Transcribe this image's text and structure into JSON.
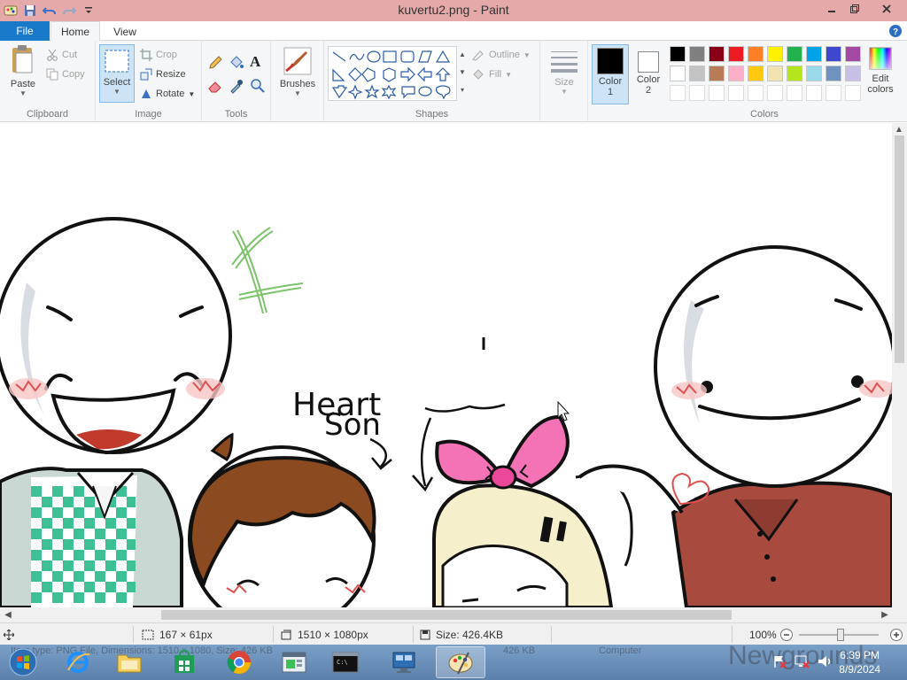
{
  "window": {
    "title": "kuvertu2.png - Paint",
    "title_bar_color": "#e6a9a9"
  },
  "quick_access": {
    "icons": [
      "paint-app-icon",
      "save-icon",
      "undo-icon",
      "redo-icon",
      "customize-qat-icon"
    ]
  },
  "tabs": {
    "file": "File",
    "home": "Home",
    "view": "View",
    "file_color": "#1979ca"
  },
  "ribbon": {
    "clipboard": {
      "label": "Clipboard",
      "paste": "Paste",
      "cut": "Cut",
      "copy": "Copy"
    },
    "image": {
      "label": "Image",
      "select": "Select",
      "crop": "Crop",
      "resize": "Resize",
      "rotate": "Rotate"
    },
    "tools": {
      "label": "Tools",
      "items": [
        "pencil-icon",
        "fill-bucket-icon",
        "text-icon",
        "eraser-icon",
        "color-picker-icon",
        "magnifier-icon"
      ]
    },
    "brushes": {
      "label": "Brushes"
    },
    "shapes": {
      "label": "Shapes",
      "outline": "Outline",
      "fill": "Fill"
    },
    "size": {
      "label": "Size"
    },
    "color1": {
      "label_line1": "Color",
      "label_line2": "1",
      "value": "#000000"
    },
    "color2": {
      "label_line1": "Color",
      "label_line2": "2",
      "value": "#ffffff"
    },
    "colors": {
      "label": "Colors",
      "palette_row1": [
        "#000000",
        "#7f7f7f",
        "#880015",
        "#ed1c24",
        "#ff7f27",
        "#fff200",
        "#22b14c",
        "#00a2e8",
        "#3f48cc",
        "#a349a4"
      ],
      "palette_row2": [
        "#ffffff",
        "#c3c3c3",
        "#b97a57",
        "#ffaec9",
        "#ffc90e",
        "#efe4b0",
        "#b5e61d",
        "#99d9ea",
        "#7092be",
        "#c8bfe7"
      ],
      "edit_line1": "Edit",
      "edit_line2": "colors"
    }
  },
  "canvas": {
    "text_heart": "Heart",
    "text_son": "Son"
  },
  "statusbar": {
    "selection": "167 × 61px",
    "dimensions": "1510 × 1080px",
    "size": "Size: 426.4KB",
    "zoom": "100%"
  },
  "taskbar": {
    "time": "6:39 PM",
    "date": "8/9/2024",
    "apps": [
      "start-icon",
      "internet-explorer-icon",
      "file-explorer-icon",
      "store-icon",
      "chrome-icon",
      "app-window-icon",
      "command-prompt-icon",
      "remote-desktop-icon",
      "paint-taskbar-icon"
    ],
    "ghost_left": "Item type: PNG File, Dimensions: 1510 x 1080, Size: 426 KB",
    "ghost_size": "426 KB",
    "ghost_computer": "Computer",
    "watermark": "Newgrounds"
  }
}
